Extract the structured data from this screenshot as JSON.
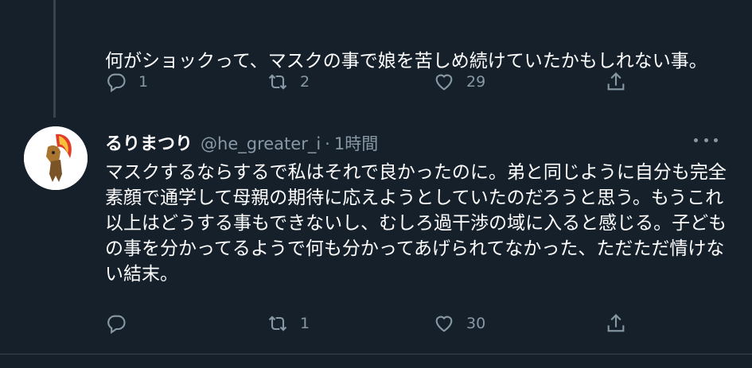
{
  "tweet_prev": {
    "text": "何がショックって、マスクの事で娘を苦しめ続けていたかもしれない事。",
    "reply_count": "1",
    "retweet_count": "2",
    "like_count": "29"
  },
  "tweet_main": {
    "display_name": "るりまつり",
    "handle": "@he_greater_i",
    "separator": "·",
    "time": "1時間",
    "text": "マスクするならするで私はそれで良かったのに。弟と同じように自分も完全素顔で通学して母親の期待に応えようとしていたのだろうと思う。もうこれ以上はどうする事もできないし、むしろ過干渉の域に入ると感じる。子どもの事を分かってるようで何も分かってあげられてなかった、ただただ情けない結末。",
    "reply_count": "",
    "retweet_count": "1",
    "like_count": "30"
  },
  "colors": {
    "background": "#15202b",
    "muted": "#8899a6",
    "divider": "#38444d"
  },
  "icons": [
    "reply-icon",
    "retweet-icon",
    "like-icon",
    "share-icon",
    "more-icon"
  ]
}
